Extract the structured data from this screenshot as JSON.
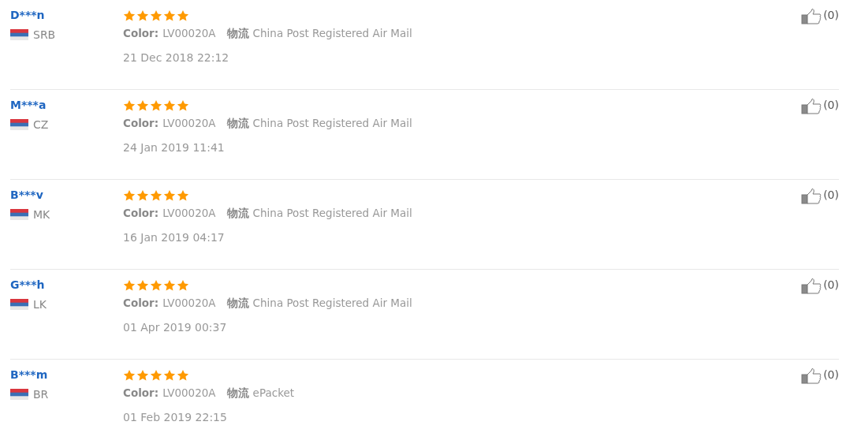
{
  "reviews": [
    {
      "name": "D***n",
      "country": "SRB",
      "stars": 5,
      "option_label": "Color:",
      "option_value": "LV00020A",
      "shipping_label": "物流",
      "shipping_value": "China Post Registered Air Mail",
      "date": "21 Dec 2018 22:12",
      "likes": "(0)"
    },
    {
      "name": "M***a",
      "country": "CZ",
      "stars": 5,
      "option_label": "Color:",
      "option_value": "LV00020A",
      "shipping_label": "物流",
      "shipping_value": "China Post Registered Air Mail",
      "date": "24 Jan 2019 11:41",
      "likes": "(0)"
    },
    {
      "name": "B***v",
      "country": "MK",
      "stars": 5,
      "option_label": "Color:",
      "option_value": "LV00020A",
      "shipping_label": "物流",
      "shipping_value": "China Post Registered Air Mail",
      "date": "16 Jan 2019 04:17",
      "likes": "(0)"
    },
    {
      "name": "G***h",
      "country": "LK",
      "stars": 5,
      "option_label": "Color:",
      "option_value": "LV00020A",
      "shipping_label": "物流",
      "shipping_value": "China Post Registered Air Mail",
      "date": "01 Apr 2019 00:37",
      "likes": "(0)"
    },
    {
      "name": "B***m",
      "country": "BR",
      "stars": 5,
      "option_label": "Color:",
      "option_value": "LV00020A",
      "shipping_label": "物流",
      "shipping_value": "ePacket",
      "date": "01 Feb 2019 22:15",
      "likes": "(0)"
    }
  ]
}
